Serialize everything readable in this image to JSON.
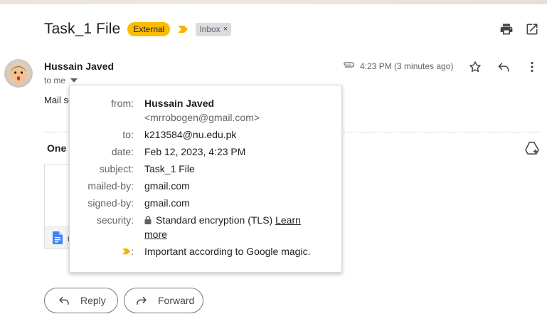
{
  "subject": "Task_1 File",
  "labels": {
    "external": "External",
    "inbox": "Inbox",
    "remove": "×"
  },
  "sender": {
    "name": "Hussain Javed",
    "to": "to me"
  },
  "message": {
    "time": "4:23 PM (3 minutes ago)",
    "body_preview": "Mail se"
  },
  "attachments": {
    "title": "One",
    "file_name": "u"
  },
  "details": {
    "from_label": "from:",
    "from_name": "Hussain Javed",
    "from_email": "<mrrobogen@gmail.com>",
    "to_label": "to:",
    "to_value": "k213584@nu.edu.pk",
    "date_label": "date:",
    "date_value": "Feb 12, 2023, 4:23 PM",
    "subject_label": "subject:",
    "subject_value": "Task_1 File",
    "mailed_label": "mailed-by:",
    "mailed_value": "gmail.com",
    "signed_label": "signed-by:",
    "signed_value": "gmail.com",
    "security_label": "security:",
    "security_value": "Standard encryption (TLS)",
    "learn": "Learn",
    "more": "more",
    "important_colon": ":",
    "important_value": "Important according to Google magic."
  },
  "actions": {
    "reply": "Reply",
    "forward": "Forward"
  },
  "colors": {
    "external_label": "#fbbc04",
    "important_marker": "#f4b400",
    "inbox_label": "#dadce0"
  },
  "icons": [
    "print-icon",
    "open-in-new-icon",
    "paperclip-icon",
    "star-icon",
    "reply-icon",
    "more-vert-icon",
    "add-to-drive-icon",
    "lock-icon",
    "important-marker-icon",
    "doc-icon",
    "forward-icon"
  ]
}
